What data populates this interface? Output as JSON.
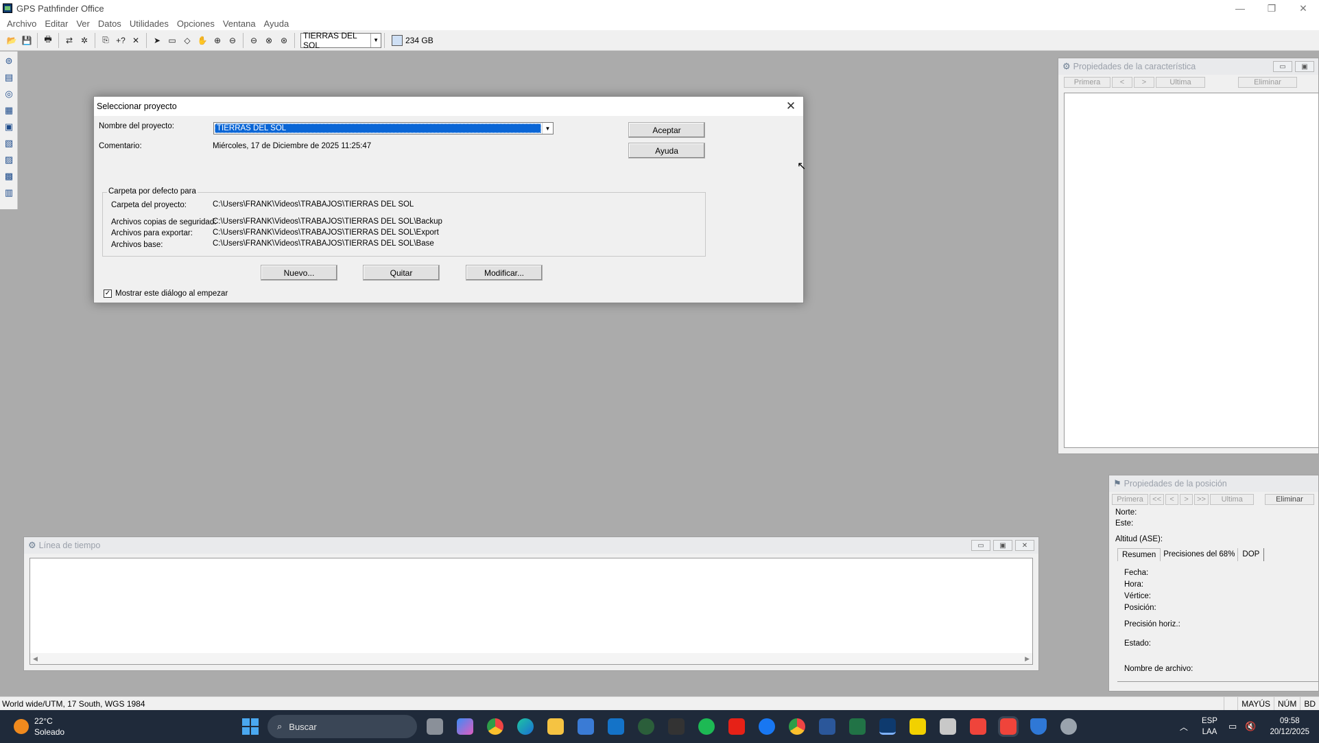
{
  "app": {
    "title": "GPS  Pathfinder Office"
  },
  "menu": [
    "Archivo",
    "Editar",
    "Ver",
    "Datos",
    "Utilidades",
    "Opciones",
    "Ventana",
    "Ayuda"
  ],
  "toolbar": {
    "project": "TIERRAS DEL SOL",
    "disk": "234 GB"
  },
  "dialog": {
    "title": "Seleccionar proyecto",
    "project_label": "Nombre del proyecto:",
    "project_value": "TIERRAS DEL SOL",
    "comment_label": "Comentario:",
    "comment_value": "Miércoles, 17 de Diciembre de 2025 11:25:47",
    "accept": "Aceptar",
    "help": "Ayuda",
    "group_title": "Carpeta por defecto para",
    "folders": [
      {
        "label": "Carpeta del proyecto:",
        "value": "C:\\Users\\FRANK\\Videos\\TRABAJOS\\TIERRAS DEL SOL"
      },
      {
        "label": "Archivos copias de seguridad:",
        "value": "C:\\Users\\FRANK\\Videos\\TRABAJOS\\TIERRAS DEL SOL\\Backup"
      },
      {
        "label": "Archivos para exportar:",
        "value": "C:\\Users\\FRANK\\Videos\\TRABAJOS\\TIERRAS DEL SOL\\Export"
      },
      {
        "label": "Archivos base:",
        "value": "C:\\Users\\FRANK\\Videos\\TRABAJOS\\TIERRAS DEL SOL\\Base"
      }
    ],
    "new": "Nuevo...",
    "remove": "Quitar",
    "modify": "Modificar...",
    "show_on_start": "Mostrar este diálogo al empezar",
    "show_on_start_checked": true
  },
  "feature_panel": {
    "title": "Propiedades de la característica",
    "nav": [
      "Primera",
      "<",
      ">",
      "Ultima",
      "Eliminar"
    ]
  },
  "position_panel": {
    "title": "Propiedades de la posición",
    "nav": [
      "Primera",
      "<<",
      "<",
      ">",
      ">>",
      "Ultima",
      "Eliminar"
    ],
    "north": "Norte:",
    "east": "Este:",
    "altitude": "Altitud (ASE):",
    "tabs": [
      "Resumen",
      "Precisiones del 68%",
      "DOP"
    ],
    "fields": [
      "Fecha:",
      "Hora:",
      "Vértice:",
      "Posición:",
      "Precisión horiz.:",
      "Estado:",
      "Nombre de archivo:"
    ]
  },
  "timeline": {
    "title": "Línea de tiempo"
  },
  "statusbar": {
    "coord": "World wide/UTM, 17 South, WGS 1984",
    "caps": "MAYÚS",
    "num": "NÚM",
    "bd": "BD"
  },
  "taskbar": {
    "temp": "22°C",
    "weather": "Soleado",
    "search": "Buscar",
    "lang1": "ESP",
    "lang2": "LAA",
    "time": "09:58",
    "date": "20/12/2025"
  }
}
